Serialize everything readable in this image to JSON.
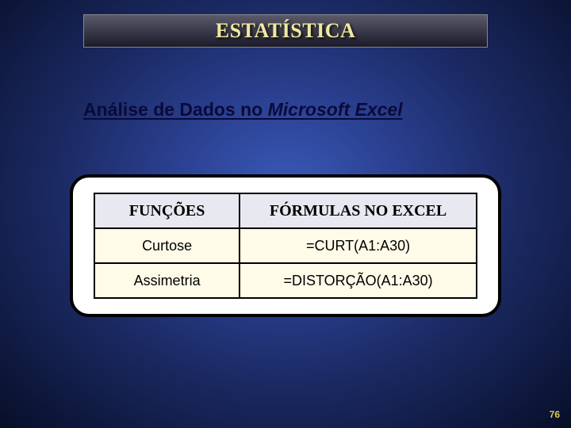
{
  "header": {
    "title": "ESTATÍSTICA"
  },
  "subtitle": {
    "prefix": "Análise de Dados no ",
    "italic": "Microsoft Excel"
  },
  "table": {
    "headers": {
      "col1": "FUNÇÕES",
      "col2": "FÓRMULAS NO EXCEL"
    },
    "rows": [
      {
        "func": "Curtose",
        "formula": "=CURT(A1:A30)"
      },
      {
        "func": "Assimetria",
        "formula": "=DISTORÇÃO(A1:A30)"
      }
    ]
  },
  "page_number": "76"
}
